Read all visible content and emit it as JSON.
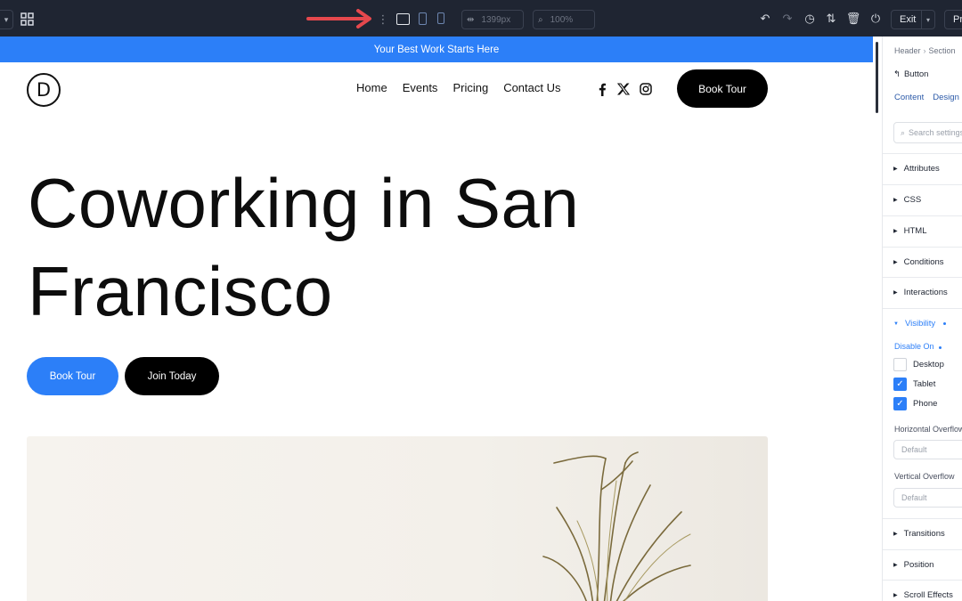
{
  "toolbar": {
    "width_value": "1399px",
    "zoom_value": "100%",
    "exit_label": "Exit",
    "preview_label": "Pr"
  },
  "site": {
    "promo_text": "Your Best Work Starts Here",
    "logo_letter": "D",
    "nav": [
      "Home",
      "Events",
      "Pricing",
      "Contact Us"
    ],
    "header_button": "Book Tour",
    "hero_title_line1": "Coworking in San",
    "hero_title_line2": "Francisco",
    "primary_button": "Book Tour",
    "secondary_button": "Join Today"
  },
  "panel": {
    "breadcrumb": [
      "Header",
      "Section"
    ],
    "element_name": "Button",
    "tabs": [
      "Content",
      "Design"
    ],
    "search_placeholder": "Search settings",
    "sections_top": [
      "Attributes",
      "CSS",
      "HTML",
      "Conditions",
      "Interactions"
    ],
    "visibility": {
      "title": "Visibility",
      "disable_on_label": "Disable On",
      "options": [
        {
          "label": "Desktop",
          "checked": false
        },
        {
          "label": "Tablet",
          "checked": true
        },
        {
          "label": "Phone",
          "checked": true
        }
      ],
      "horizontal_overflow_label": "Horizontal Overflow",
      "horizontal_overflow_value": "Default",
      "vertical_overflow_label": "Vertical Overflow",
      "vertical_overflow_value": "Default"
    },
    "sections_bottom": [
      "Transitions",
      "Position",
      "Scroll Effects"
    ]
  },
  "colors": {
    "toolbar_bg": "#1f2532",
    "accent_blue": "#2c7ff8",
    "annotation_arrow": "#e5484d"
  }
}
